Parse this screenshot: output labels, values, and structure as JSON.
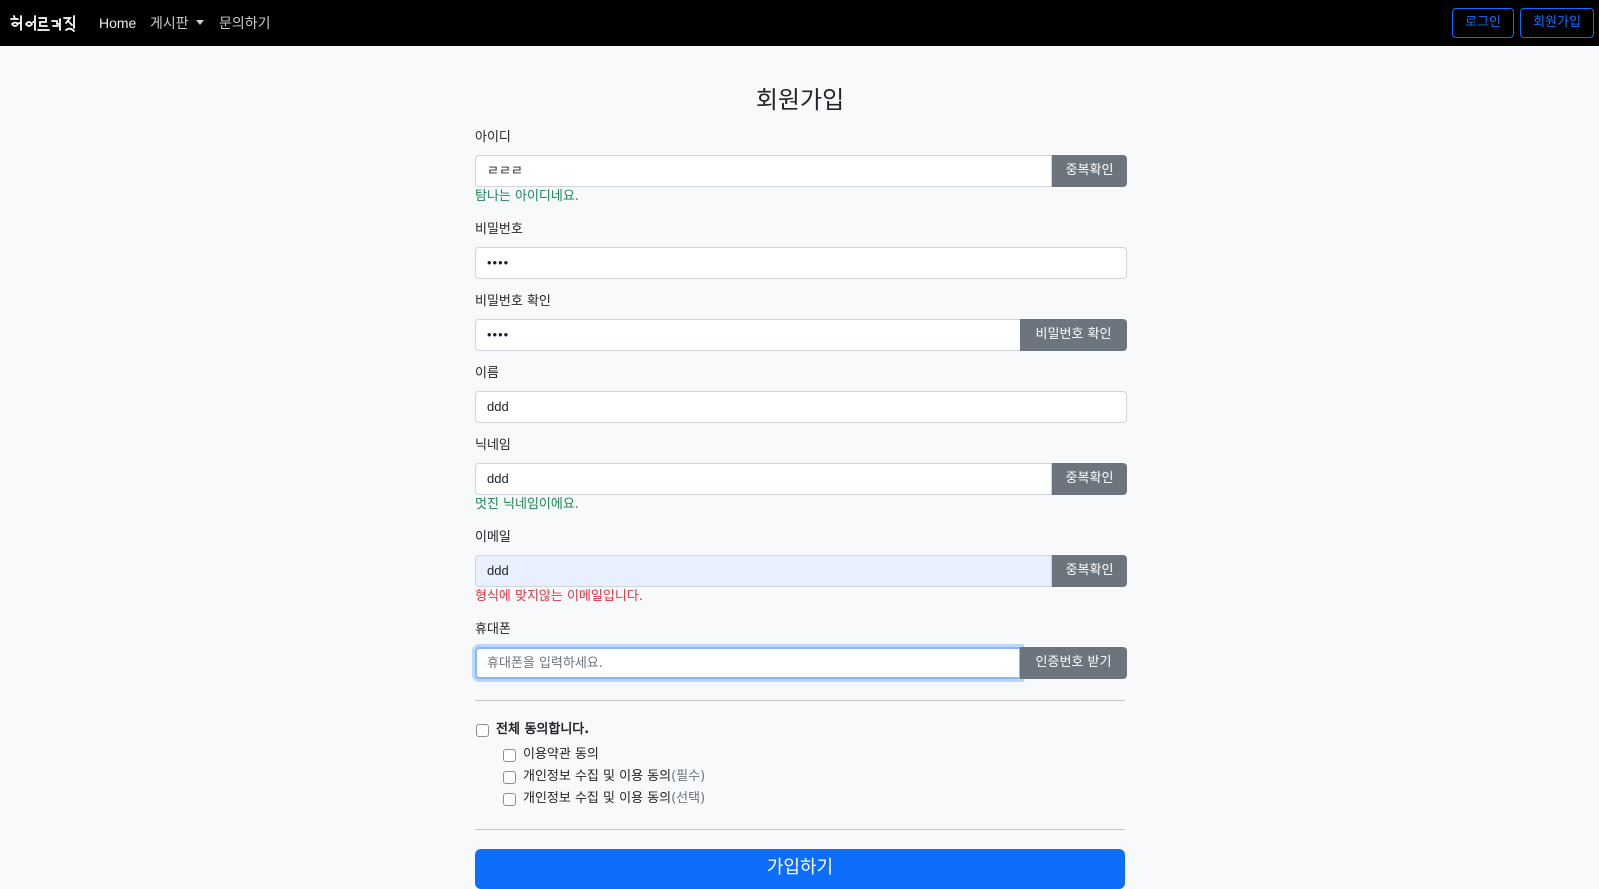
{
  "nav": {
    "brand": "히어로그래",
    "links": [
      "Home",
      "게시판",
      "문의하기"
    ],
    "login": "로그인",
    "signup": "회원가입"
  },
  "form": {
    "title": "회원가입",
    "id": {
      "label": "아이디",
      "value": "ㄹㄹㄹ",
      "button": "중복확인",
      "message": "탐나는 아이디네요."
    },
    "password": {
      "label": "비밀번호",
      "value": "••••"
    },
    "password_confirm": {
      "label": "비밀번호 확인",
      "value": "••••",
      "button": "비밀번호 확인"
    },
    "name": {
      "label": "이름",
      "value": "ddd"
    },
    "nickname": {
      "label": "닉네임",
      "value": "ddd",
      "button": "중복확인",
      "message": "멋진 닉네임이에요."
    },
    "email": {
      "label": "이메일",
      "value": "ddd",
      "button": "중복확인",
      "message": "형식에 맞지않는 이메일입니다."
    },
    "phone": {
      "label": "휴대폰",
      "placeholder": "휴대폰을 입력하세요.",
      "button": "인증번호 받기"
    },
    "agree_all": "전체 동의합니다.",
    "agreements": [
      {
        "label": "이용약관 동의",
        "note": ""
      },
      {
        "label": "개인정보 수집 및 이용 동의",
        "note": "(필수)"
      },
      {
        "label": "개인정보 수집 및 이용 동의",
        "note": "(선택)"
      }
    ],
    "submit": "가입하기"
  },
  "colors": {
    "primary": "#0d6efd",
    "secondary": "#6c757d",
    "success": "#198754",
    "danger": "#dc3545"
  }
}
